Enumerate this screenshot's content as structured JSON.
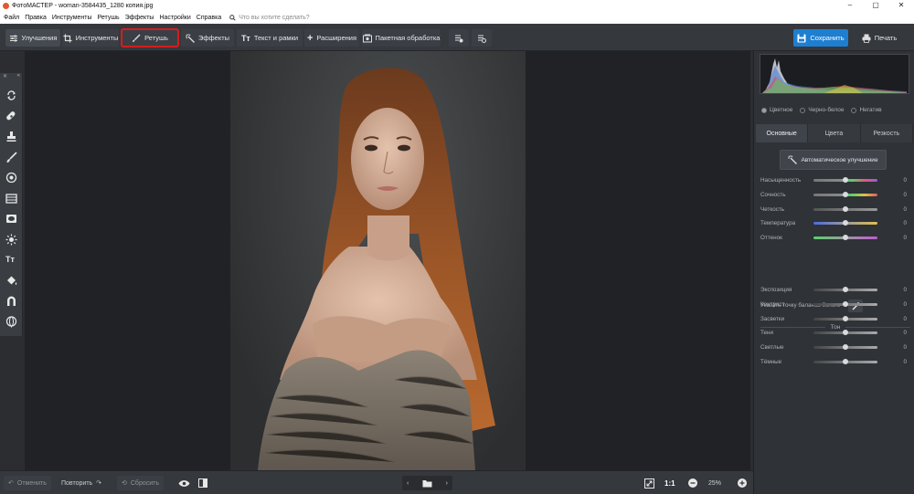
{
  "window": {
    "title": "ФотоМАСТЕР - woman-3584435_1280 копия.jpg",
    "minimize": "–",
    "maximize": "▢",
    "close": "✕"
  },
  "menu": {
    "items": [
      "Файл",
      "Правка",
      "Инструменты",
      "Ретушь",
      "Эффекты",
      "Настройки",
      "Справка"
    ],
    "search_placeholder": "Что вы хотите сделать?"
  },
  "toolbar": {
    "enhance": "Улучшения",
    "tools": "Инструменты",
    "retouch": "Ретушь",
    "effects": "Эффекты",
    "text": "Текст и рамки",
    "extensions": "Расширения",
    "batch": "Пакетная обработка",
    "save": "Сохранить",
    "print": "Печать"
  },
  "bottom": {
    "undo": "Отменить",
    "redo": "Повторить",
    "reset": "Сбросить",
    "ratio": "1:1",
    "zoom": "25%"
  },
  "panel": {
    "modes": [
      "Цветное",
      "Черно-белое",
      "Негатив"
    ],
    "tabs": [
      "Основные",
      "Цвета",
      "Резкость"
    ],
    "auto_button": "Автоматическое улучшение",
    "color_sliders": [
      {
        "label": "Насыщенность",
        "value": "0"
      },
      {
        "label": "Сочность",
        "value": "0"
      },
      {
        "label": "Четкость",
        "value": "0"
      },
      {
        "label": "Температура",
        "value": "0"
      },
      {
        "label": "Оттенок",
        "value": "0"
      }
    ],
    "white_balance": "Указать точку баланса белого",
    "tone_header": "Тон",
    "tone_sliders": [
      {
        "label": "Экспозиция",
        "value": "0"
      },
      {
        "label": "Контраст",
        "value": "0"
      },
      {
        "label": "Засветки",
        "value": "0"
      },
      {
        "label": "Тени",
        "value": "0"
      },
      {
        "label": "Светлые",
        "value": "0"
      },
      {
        "label": "Тёмные",
        "value": "0"
      }
    ]
  },
  "colors": {
    "accent": "#1e7fd0",
    "highlight": "#d51d1d"
  }
}
